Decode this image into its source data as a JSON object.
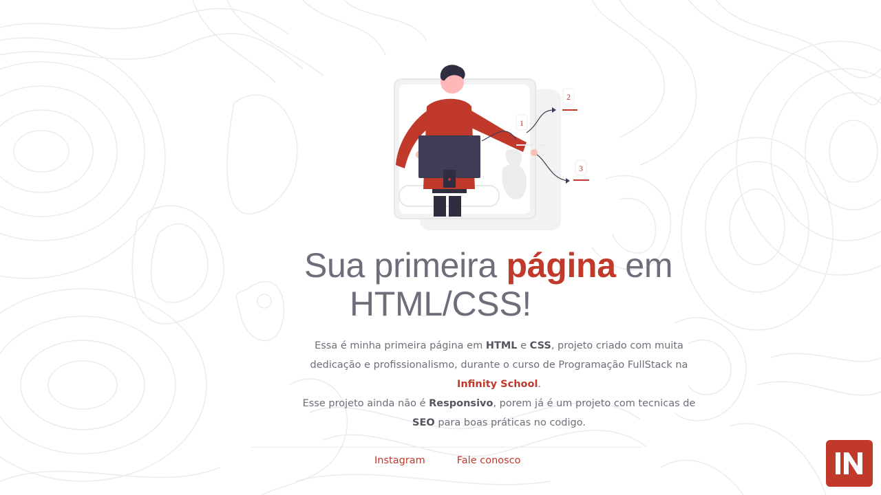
{
  "hero": {
    "title_part1": "Sua primeira ",
    "title_accent": "página",
    "title_part2": " em",
    "title_line2": "HTML/CSS!"
  },
  "description": {
    "p1_a": "Essa é minha primeira página em ",
    "p1_html": "HTML",
    "p1_b": " e ",
    "p1_css": "CSS",
    "p1_c": ", projeto criado com muita dedicação e profissionalismo, durante o curso de Programação FullStack na ",
    "p1_school": "Infinity School",
    "p1_d": ".",
    "p2_a": "Esse projeto ainda não é ",
    "p2_responsive": "Responsivo",
    "p2_b": ", porem já é um projeto com tecnicas de ",
    "p2_seo": "SEO",
    "p2_c": " para boas práticas no codigo."
  },
  "footer": {
    "instagram_label": "Instagram",
    "contact_label": "Fale conosco"
  },
  "illustration": {
    "step_labels": [
      "1",
      "2",
      "3"
    ]
  },
  "logo": {
    "text": "IN"
  },
  "colors": {
    "accent": "#c0392b",
    "text": "#6e6d7a",
    "dark": "#3f3d56"
  }
}
